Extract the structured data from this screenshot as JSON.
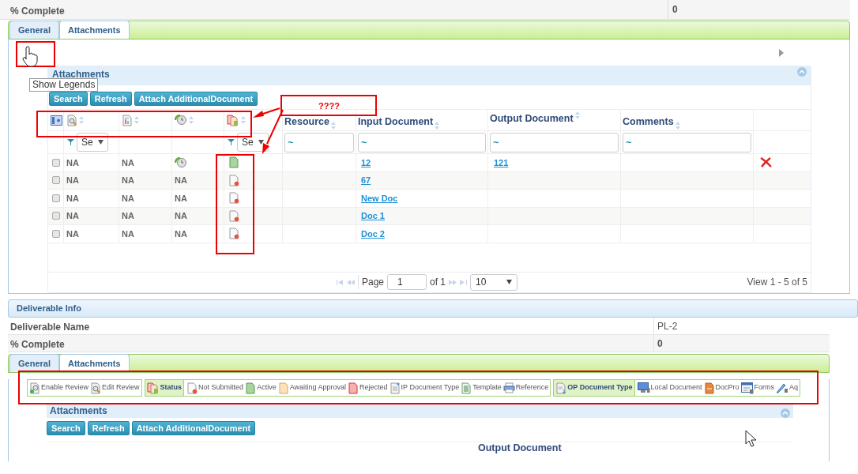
{
  "top_fields": [
    {
      "label": "% Complete",
      "value": "0"
    }
  ],
  "tabs": [
    {
      "label": "General",
      "selected": false
    },
    {
      "label": "Attachments",
      "selected": true
    }
  ],
  "legend_tooltip": "Show Legends",
  "grid": {
    "title": "Attachments",
    "buttons": [
      "Search",
      "Refresh",
      "Attach AdditionalDocument"
    ],
    "icon_columns": [
      {
        "kind": "review"
      },
      {
        "kind": "edit"
      },
      {
        "kind": "history"
      },
      {
        "kind": "status"
      }
    ],
    "columns": [
      "Resource",
      "Input Document",
      "Output Document",
      "Comments"
    ],
    "selects": [
      "Se",
      "Se"
    ],
    "filters": [
      "~",
      "~",
      "~",
      "~"
    ],
    "rows": [
      {
        "checked": false,
        "cells": [
          "NA",
          "NA",
          ""
        ],
        "history": true,
        "kind": "active",
        "input": "12",
        "output": "121",
        "deletable": true
      },
      {
        "checked": false,
        "cells": [
          "NA",
          "NA",
          "NA"
        ],
        "history": false,
        "kind": "not-submitted",
        "input": "67",
        "output": "",
        "deletable": false
      },
      {
        "checked": false,
        "cells": [
          "NA",
          "NA",
          "NA"
        ],
        "history": false,
        "kind": "not-submitted",
        "input": "New Doc",
        "output": "",
        "deletable": false
      },
      {
        "checked": false,
        "cells": [
          "NA",
          "NA",
          "NA"
        ],
        "history": false,
        "kind": "not-submitted",
        "input": "Doc 1",
        "output": "",
        "deletable": false
      },
      {
        "checked": false,
        "cells": [
          "NA",
          "NA",
          "NA"
        ],
        "history": false,
        "kind": "not-submitted",
        "input": "Doc 2",
        "output": "",
        "deletable": false
      }
    ],
    "pager": {
      "page_label": "Page",
      "page": "1",
      "of": "of 1",
      "size": "10",
      "view": "View 1 - 5 of 5"
    }
  },
  "annotation_note": "????",
  "deliverable_info": {
    "title": "Deliverable Info",
    "fields": [
      {
        "label": "Deliverable Name",
        "value": "PL-2"
      },
      {
        "label": "% Complete",
        "value": "0"
      }
    ]
  },
  "tabs_2": [
    {
      "label": "General",
      "selected": false
    },
    {
      "label": "Attachments",
      "selected": true
    }
  ],
  "legend": {
    "groups": [
      {
        "items": [
          {
            "kind": "enable-review",
            "label": "Enable Review"
          },
          {
            "kind": "review",
            "label": "Edit Review"
          }
        ]
      },
      {
        "heading": {
          "kind": "status",
          "label": "Status"
        },
        "items": [
          {
            "kind": "not-submitted",
            "label": "Not Submitted"
          },
          {
            "kind": "active",
            "label": "Active"
          },
          {
            "kind": "awaiting",
            "label": "Awaiting Approval"
          },
          {
            "kind": "rejected",
            "label": "Rejected"
          },
          {
            "kind": "ip-type",
            "label": "IP Document Type"
          },
          {
            "kind": "template",
            "label": "Template"
          },
          {
            "kind": "reference",
            "label": "Reference"
          }
        ]
      },
      {
        "heading": {
          "kind": "op-type",
          "label": "OP Document Type"
        },
        "items": [
          {
            "kind": "local",
            "label": "Local Document"
          },
          {
            "kind": "docpro",
            "label": "DocPro"
          },
          {
            "kind": "forms",
            "label": "Forms"
          },
          {
            "kind": "aq",
            "label": "Aq"
          }
        ]
      }
    ]
  },
  "grid_2": {
    "title": "Attachments",
    "buttons": [
      "Search",
      "Refresh",
      "Attach AdditionalDocument"
    ],
    "columns": [
      "Output Document"
    ]
  }
}
